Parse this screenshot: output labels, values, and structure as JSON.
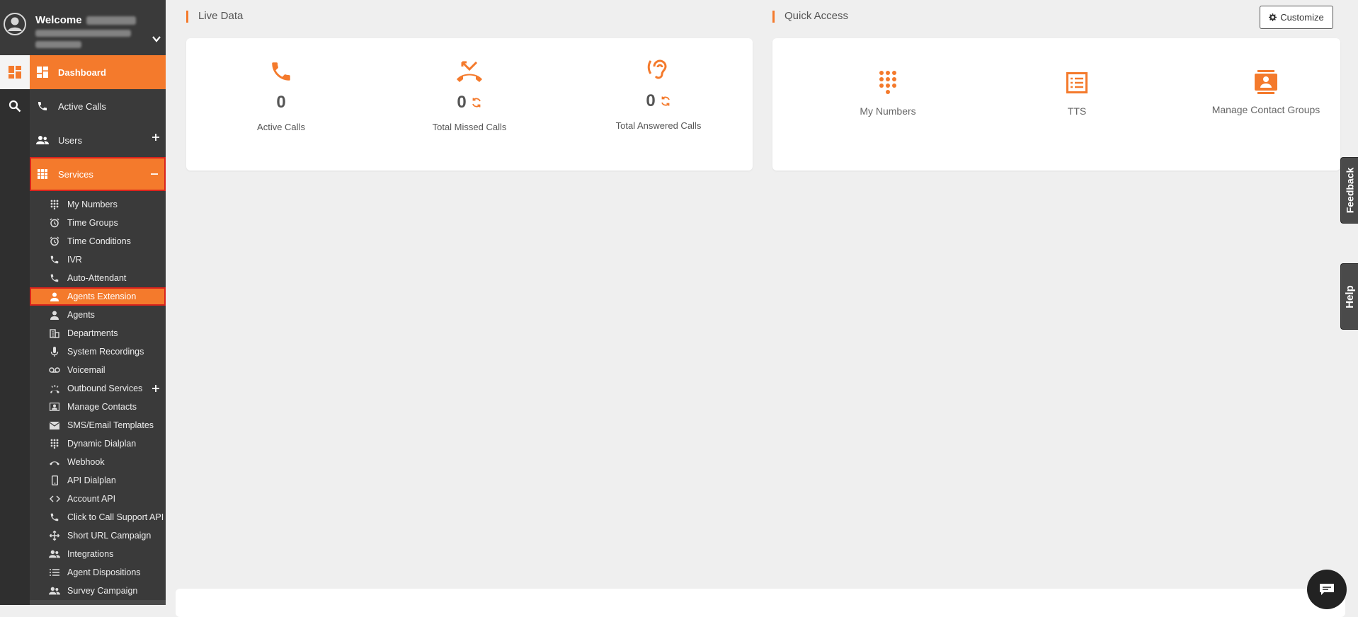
{
  "colors": {
    "accent": "#f47a2c",
    "sidebar": "#3a3a3a",
    "highlight_border": "#d9231c"
  },
  "header": {
    "welcome_label": "Welcome",
    "user_name_redacted": true
  },
  "sidebar": {
    "items": [
      {
        "label": "Dashboard",
        "icon": "dashboard-icon"
      },
      {
        "label": "Active Calls",
        "icon": "phone-icon"
      },
      {
        "label": "Users",
        "icon": "users-icon"
      },
      {
        "label": "Services",
        "icon": "grid-icon"
      }
    ],
    "services_submenu": [
      {
        "label": "My Numbers",
        "icon": "dialpad-icon"
      },
      {
        "label": "Time Groups",
        "icon": "alarm-icon"
      },
      {
        "label": "Time Conditions",
        "icon": "alarm-icon"
      },
      {
        "label": "IVR",
        "icon": "phone-forward-icon"
      },
      {
        "label": "Auto-Attendant",
        "icon": "phone-forward-icon"
      },
      {
        "label": "Agents Extension",
        "icon": "person-icon"
      },
      {
        "label": "Agents",
        "icon": "person-icon"
      },
      {
        "label": "Departments",
        "icon": "building-icon"
      },
      {
        "label": "System Recordings",
        "icon": "mic-icon"
      },
      {
        "label": "Voicemail",
        "icon": "voicemail-icon"
      },
      {
        "label": "Outbound Services",
        "icon": "ringing-phone-icon"
      },
      {
        "label": "Manage Contacts",
        "icon": "contact-card-icon"
      },
      {
        "label": "SMS/Email Templates",
        "icon": "mail-icon"
      },
      {
        "label": "Dynamic Dialplan",
        "icon": "dialpad-icon"
      },
      {
        "label": "Webhook",
        "icon": "hangup-icon"
      },
      {
        "label": "API Dialplan",
        "icon": "mobile-icon"
      },
      {
        "label": "Account API",
        "icon": "code-icon"
      },
      {
        "label": "Click to Call Support API",
        "icon": "phone-icon"
      },
      {
        "label": "Short URL Campaign",
        "icon": "move-icon"
      },
      {
        "label": "Integrations",
        "icon": "group-icon"
      },
      {
        "label": "Agent Dispositions",
        "icon": "list-icon"
      },
      {
        "label": "Survey Campaign",
        "icon": "group-icon"
      }
    ]
  },
  "live_data": {
    "title": "Live Data",
    "stats": [
      {
        "value": "0",
        "label": "Active Calls",
        "icon": "phone-icon",
        "refresh": false
      },
      {
        "value": "0",
        "label": "Total Missed Calls",
        "icon": "missed-call-icon",
        "refresh": true
      },
      {
        "value": "0",
        "label": "Total Answered Calls",
        "icon": "hearing-icon",
        "refresh": true
      }
    ]
  },
  "quick_access": {
    "title": "Quick Access",
    "customize_label": "Customize",
    "items": [
      {
        "label": "My Numbers",
        "icon": "dialpad-icon"
      },
      {
        "label": "TTS",
        "icon": "list-box-icon"
      },
      {
        "label": "Manage Contact Groups",
        "icon": "contact-book-icon"
      }
    ]
  },
  "side_tabs": {
    "feedback": "Feedback",
    "help": "Help"
  }
}
